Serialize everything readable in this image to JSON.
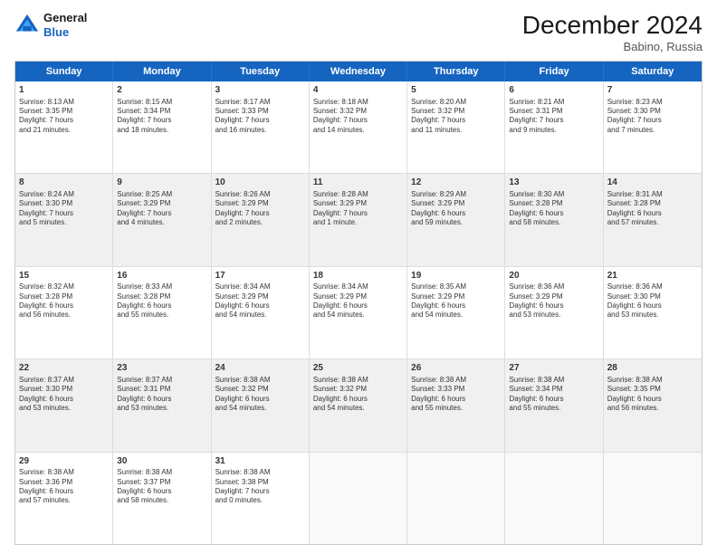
{
  "header": {
    "logo_line1": "General",
    "logo_line2": "Blue",
    "title": "December 2024",
    "subtitle": "Babino, Russia"
  },
  "weekdays": [
    "Sunday",
    "Monday",
    "Tuesday",
    "Wednesday",
    "Thursday",
    "Friday",
    "Saturday"
  ],
  "rows": [
    [
      {
        "day": "1",
        "lines": [
          "Sunrise: 8:13 AM",
          "Sunset: 3:35 PM",
          "Daylight: 7 hours",
          "and 21 minutes."
        ]
      },
      {
        "day": "2",
        "lines": [
          "Sunrise: 8:15 AM",
          "Sunset: 3:34 PM",
          "Daylight: 7 hours",
          "and 18 minutes."
        ]
      },
      {
        "day": "3",
        "lines": [
          "Sunrise: 8:17 AM",
          "Sunset: 3:33 PM",
          "Daylight: 7 hours",
          "and 16 minutes."
        ]
      },
      {
        "day": "4",
        "lines": [
          "Sunrise: 8:18 AM",
          "Sunset: 3:32 PM",
          "Daylight: 7 hours",
          "and 14 minutes."
        ]
      },
      {
        "day": "5",
        "lines": [
          "Sunrise: 8:20 AM",
          "Sunset: 3:32 PM",
          "Daylight: 7 hours",
          "and 11 minutes."
        ]
      },
      {
        "day": "6",
        "lines": [
          "Sunrise: 8:21 AM",
          "Sunset: 3:31 PM",
          "Daylight: 7 hours",
          "and 9 minutes."
        ]
      },
      {
        "day": "7",
        "lines": [
          "Sunrise: 8:23 AM",
          "Sunset: 3:30 PM",
          "Daylight: 7 hours",
          "and 7 minutes."
        ]
      }
    ],
    [
      {
        "day": "8",
        "lines": [
          "Sunrise: 8:24 AM",
          "Sunset: 3:30 PM",
          "Daylight: 7 hours",
          "and 5 minutes."
        ]
      },
      {
        "day": "9",
        "lines": [
          "Sunrise: 8:25 AM",
          "Sunset: 3:29 PM",
          "Daylight: 7 hours",
          "and 4 minutes."
        ]
      },
      {
        "day": "10",
        "lines": [
          "Sunrise: 8:26 AM",
          "Sunset: 3:29 PM",
          "Daylight: 7 hours",
          "and 2 minutes."
        ]
      },
      {
        "day": "11",
        "lines": [
          "Sunrise: 8:28 AM",
          "Sunset: 3:29 PM",
          "Daylight: 7 hours",
          "and 1 minute."
        ]
      },
      {
        "day": "12",
        "lines": [
          "Sunrise: 8:29 AM",
          "Sunset: 3:29 PM",
          "Daylight: 6 hours",
          "and 59 minutes."
        ]
      },
      {
        "day": "13",
        "lines": [
          "Sunrise: 8:30 AM",
          "Sunset: 3:28 PM",
          "Daylight: 6 hours",
          "and 58 minutes."
        ]
      },
      {
        "day": "14",
        "lines": [
          "Sunrise: 8:31 AM",
          "Sunset: 3:28 PM",
          "Daylight: 6 hours",
          "and 57 minutes."
        ]
      }
    ],
    [
      {
        "day": "15",
        "lines": [
          "Sunrise: 8:32 AM",
          "Sunset: 3:28 PM",
          "Daylight: 6 hours",
          "and 56 minutes."
        ]
      },
      {
        "day": "16",
        "lines": [
          "Sunrise: 8:33 AM",
          "Sunset: 3:28 PM",
          "Daylight: 6 hours",
          "and 55 minutes."
        ]
      },
      {
        "day": "17",
        "lines": [
          "Sunrise: 8:34 AM",
          "Sunset: 3:29 PM",
          "Daylight: 6 hours",
          "and 54 minutes."
        ]
      },
      {
        "day": "18",
        "lines": [
          "Sunrise: 8:34 AM",
          "Sunset: 3:29 PM",
          "Daylight: 6 hours",
          "and 54 minutes."
        ]
      },
      {
        "day": "19",
        "lines": [
          "Sunrise: 8:35 AM",
          "Sunset: 3:29 PM",
          "Daylight: 6 hours",
          "and 54 minutes."
        ]
      },
      {
        "day": "20",
        "lines": [
          "Sunrise: 8:36 AM",
          "Sunset: 3:29 PM",
          "Daylight: 6 hours",
          "and 53 minutes."
        ]
      },
      {
        "day": "21",
        "lines": [
          "Sunrise: 8:36 AM",
          "Sunset: 3:30 PM",
          "Daylight: 6 hours",
          "and 53 minutes."
        ]
      }
    ],
    [
      {
        "day": "22",
        "lines": [
          "Sunrise: 8:37 AM",
          "Sunset: 3:30 PM",
          "Daylight: 6 hours",
          "and 53 minutes."
        ]
      },
      {
        "day": "23",
        "lines": [
          "Sunrise: 8:37 AM",
          "Sunset: 3:31 PM",
          "Daylight: 6 hours",
          "and 53 minutes."
        ]
      },
      {
        "day": "24",
        "lines": [
          "Sunrise: 8:38 AM",
          "Sunset: 3:32 PM",
          "Daylight: 6 hours",
          "and 54 minutes."
        ]
      },
      {
        "day": "25",
        "lines": [
          "Sunrise: 8:38 AM",
          "Sunset: 3:32 PM",
          "Daylight: 6 hours",
          "and 54 minutes."
        ]
      },
      {
        "day": "26",
        "lines": [
          "Sunrise: 8:38 AM",
          "Sunset: 3:33 PM",
          "Daylight: 6 hours",
          "and 55 minutes."
        ]
      },
      {
        "day": "27",
        "lines": [
          "Sunrise: 8:38 AM",
          "Sunset: 3:34 PM",
          "Daylight: 6 hours",
          "and 55 minutes."
        ]
      },
      {
        "day": "28",
        "lines": [
          "Sunrise: 8:38 AM",
          "Sunset: 3:35 PM",
          "Daylight: 6 hours",
          "and 56 minutes."
        ]
      }
    ],
    [
      {
        "day": "29",
        "lines": [
          "Sunrise: 8:38 AM",
          "Sunset: 3:36 PM",
          "Daylight: 6 hours",
          "and 57 minutes."
        ]
      },
      {
        "day": "30",
        "lines": [
          "Sunrise: 8:38 AM",
          "Sunset: 3:37 PM",
          "Daylight: 6 hours",
          "and 58 minutes."
        ]
      },
      {
        "day": "31",
        "lines": [
          "Sunrise: 8:38 AM",
          "Sunset: 3:38 PM",
          "Daylight: 7 hours",
          "and 0 minutes."
        ]
      },
      {
        "day": "",
        "lines": []
      },
      {
        "day": "",
        "lines": []
      },
      {
        "day": "",
        "lines": []
      },
      {
        "day": "",
        "lines": []
      }
    ]
  ]
}
